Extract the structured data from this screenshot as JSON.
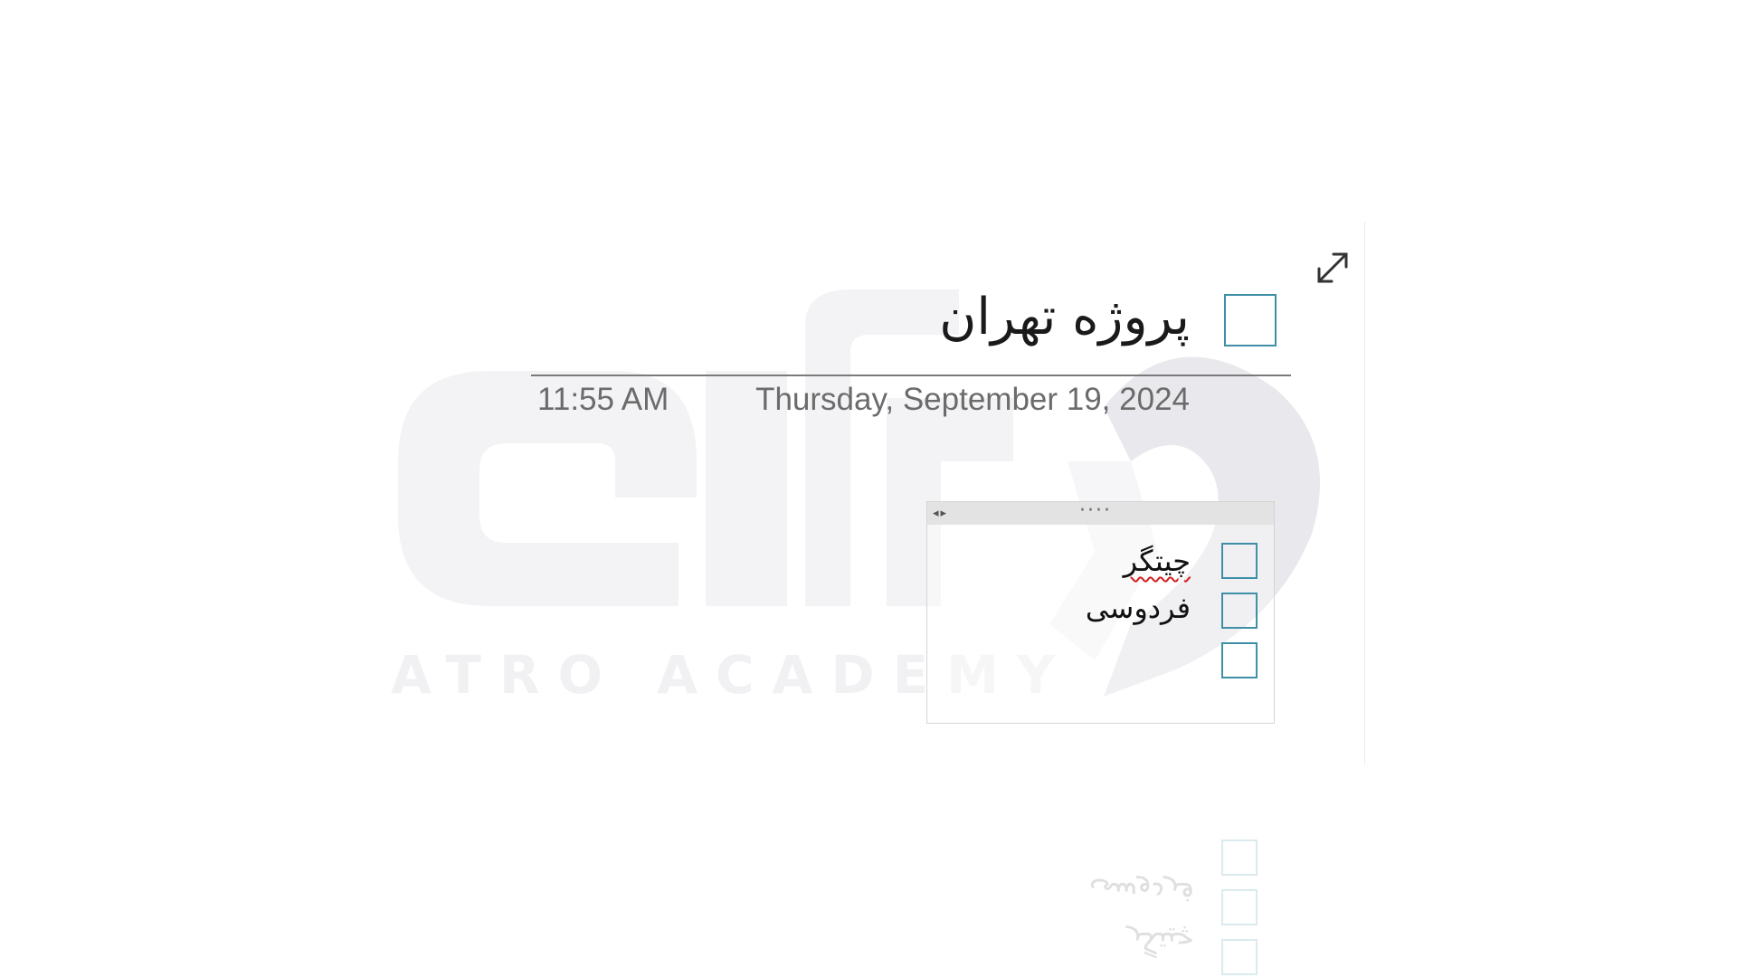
{
  "note": {
    "title": "پروژه تهران",
    "time": "11:55 AM",
    "date": "Thursday, September 19, 2024"
  },
  "watermark": {
    "text": "ATRO ACADEMY"
  },
  "checklist": {
    "items": [
      {
        "label": "چیتگر",
        "checked": false,
        "misspelled": true
      },
      {
        "label": "فردوسی",
        "checked": false,
        "misspelled": false
      },
      {
        "label": "",
        "checked": false,
        "misspelled": false
      }
    ]
  },
  "handle": {
    "arrows": "◂▸",
    "dots": "····"
  },
  "icons": {
    "expand": "expand-icon",
    "move_handle": "move-handle-icon"
  },
  "colors": {
    "checkbox_border": "#3f8fa7",
    "spell_underline": "#d22020",
    "text_secondary": "#6b6b6b"
  }
}
